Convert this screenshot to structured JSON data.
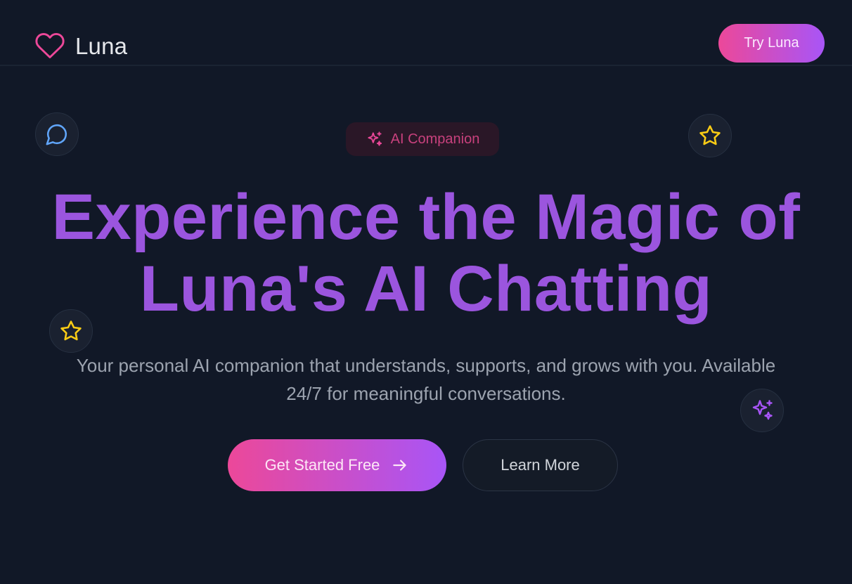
{
  "header": {
    "brand_name": "Luna",
    "brand_icon": "heart-icon",
    "cta_label": "Try Luna"
  },
  "hero": {
    "badge_label": "AI Companion",
    "badge_icon": "sparkles-icon",
    "headline_line1": "Experience the Magic of",
    "headline_line2": "Luna's AI Chatting",
    "subtitle": "Your personal AI companion that understands, supports, and grows with you. Available 24/7 for meaningful conversations.",
    "primary_button_label": "Get Started Free",
    "primary_button_icon": "arrow-right-icon",
    "secondary_button_label": "Learn More"
  },
  "floating_icons": [
    "chat-bubble-icon",
    "star-icon",
    "star-icon",
    "sparkles-icon"
  ],
  "colors": {
    "background": "#111827",
    "accent_pink": "#ec4899",
    "accent_purple": "#a855f7",
    "headline": "#9b55de",
    "star": "#facc15",
    "chat_icon": "#60a5fa"
  }
}
